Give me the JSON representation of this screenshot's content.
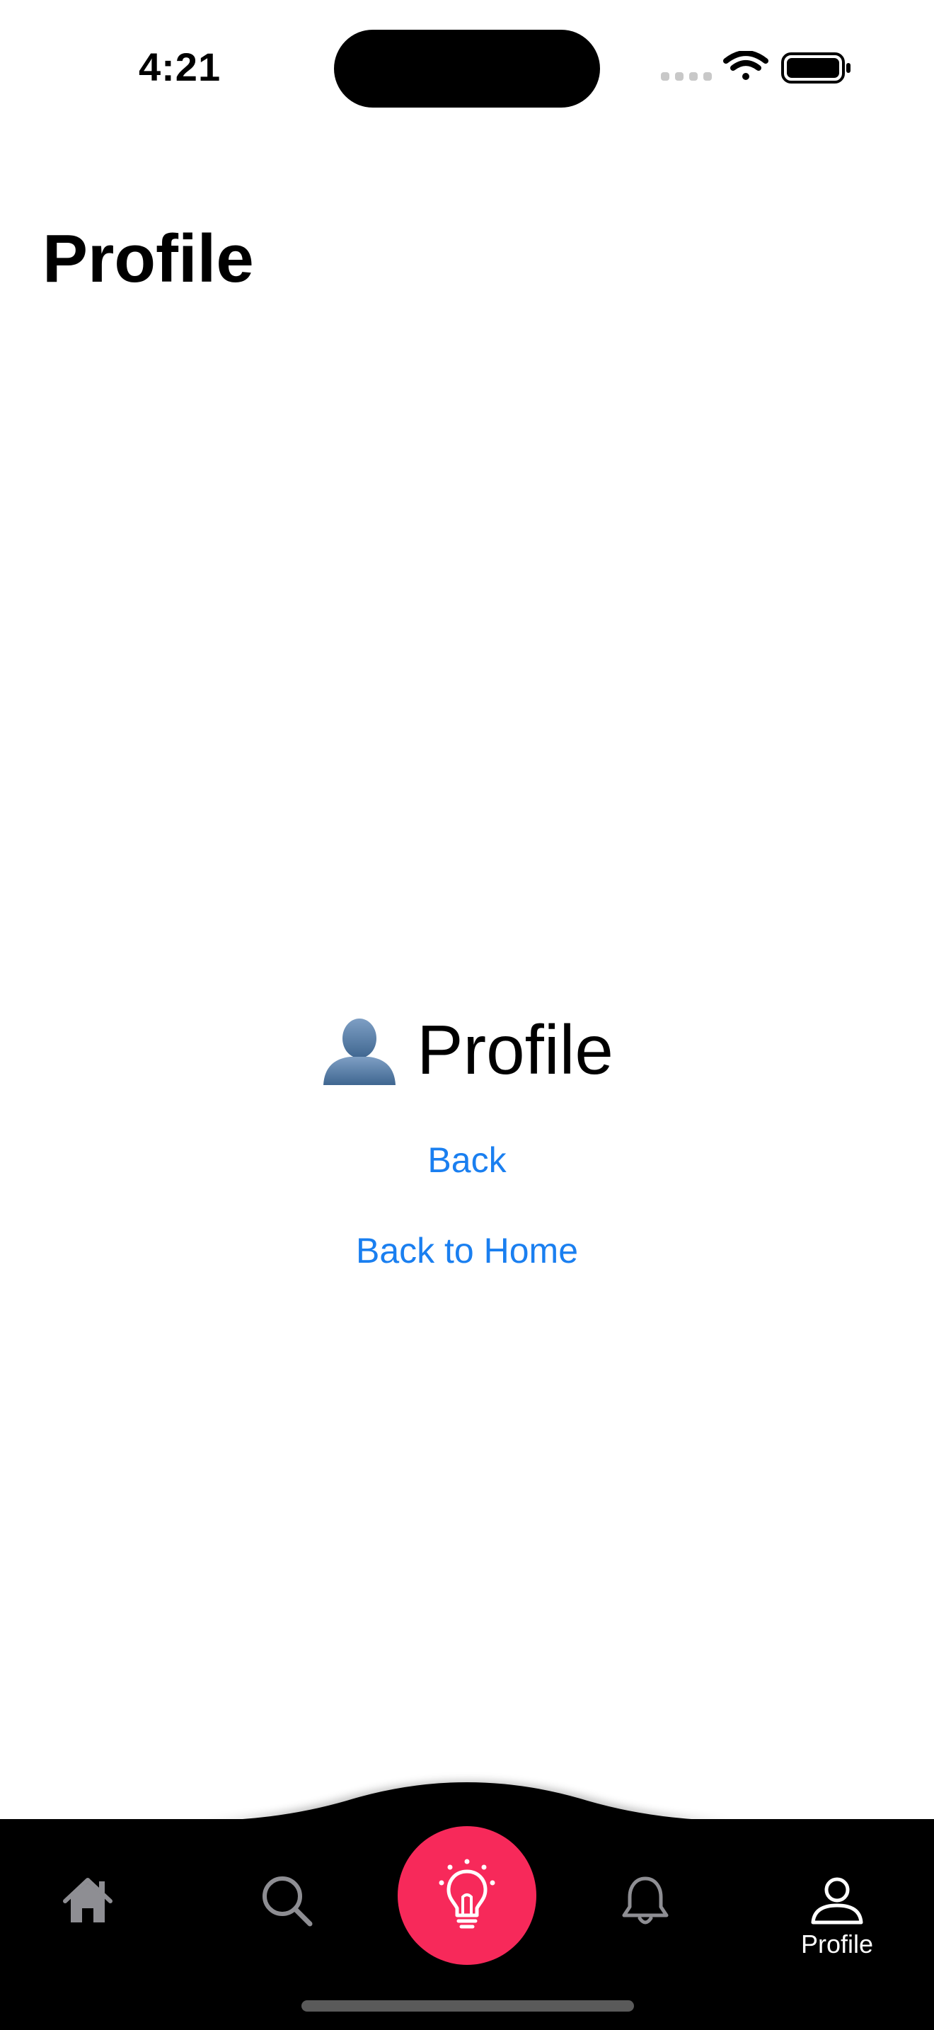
{
  "status_bar": {
    "time": "4:21"
  },
  "header": {
    "title": "Profile"
  },
  "main": {
    "heading": "Profile",
    "heading_icon": "bust-in-silhouette-icon",
    "links": {
      "back": "Back",
      "home": "Back to Home"
    },
    "link_color": "#1a7ff0"
  },
  "tab_bar": {
    "items": [
      {
        "name": "home",
        "icon": "house-icon",
        "label": ""
      },
      {
        "name": "search",
        "icon": "magnifier-icon",
        "label": ""
      },
      {
        "name": "ideas",
        "icon": "lightbulb-icon",
        "label": ""
      },
      {
        "name": "notifications",
        "icon": "bell-icon",
        "label": ""
      },
      {
        "name": "profile",
        "icon": "person-icon",
        "label": "Profile"
      }
    ],
    "active": "profile",
    "fab_color": "#f7295a",
    "background": "#000000"
  }
}
